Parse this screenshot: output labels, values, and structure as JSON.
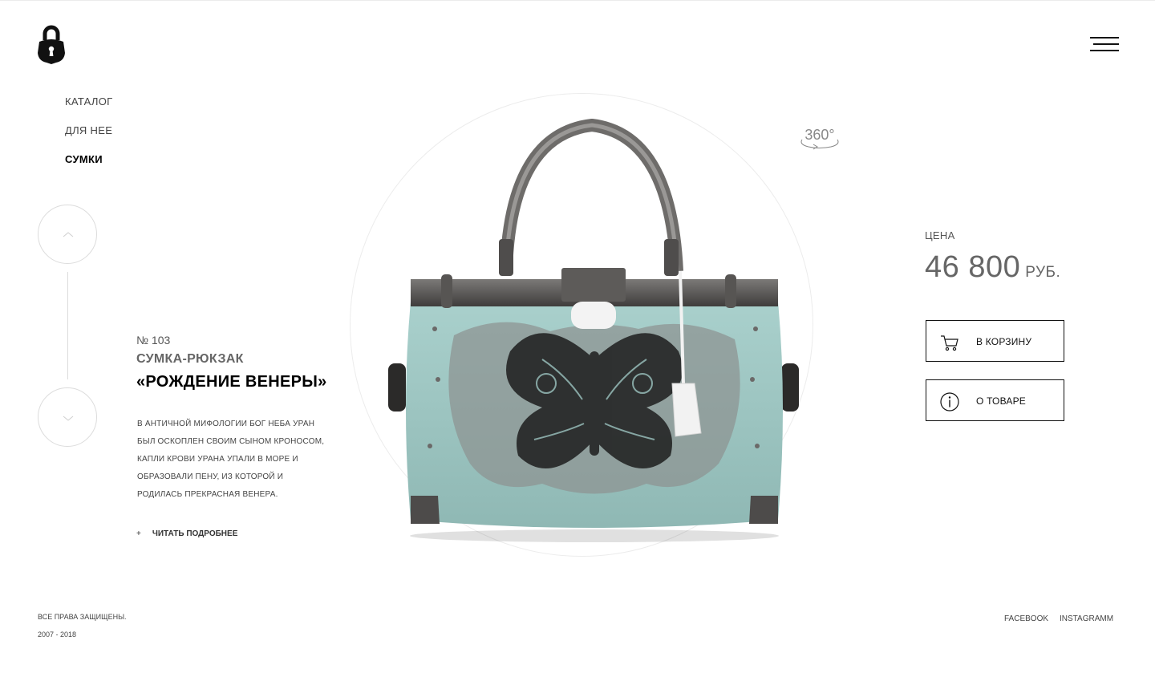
{
  "header": {
    "logo_icon": "padlock-logo-icon",
    "menu_icon": "hamburger-menu-icon"
  },
  "breadcrumbs": [
    {
      "label": "КАТАЛОГ",
      "active": false
    },
    {
      "label": "ДЛЯ НЕЕ",
      "active": false
    },
    {
      "label": "СУМКИ",
      "active": true
    }
  ],
  "slider_nav": {
    "prev_icon": "chevron-up-icon",
    "next_icon": "chevron-down-icon"
  },
  "product": {
    "number": "№ 103",
    "type": "СУМКА-РЮКЗАК",
    "name": "«РОЖДЕНИЕ ВЕНЕРЫ»",
    "description": "В АНТИЧНОЙ МИФОЛОГИИ БОГ НЕБА УРАН БЫЛ ОСКОПЛЕН СВОИМ СЫНОМ КРОНОСОМ, КАПЛИ КРОВИ УРАНА УПАЛИ В МОРЕ И ОБРАЗОВАЛИ ПЕНУ, ИЗ КОТОРОЙ И РОДИЛАСЬ ПРЕКРАСНАЯ ВЕНЕРА.",
    "read_more_plus": "+",
    "read_more": "ЧИТАТЬ ПОДРОБНЕЕ",
    "view_360": "360°",
    "image_icon": "mint-handbag-image",
    "colors": {
      "bag_body": "#9cc4c0",
      "frame": "#5a5856"
    }
  },
  "pricing": {
    "label": "ЦЕНА",
    "value": "46 800",
    "currency": "РУБ."
  },
  "actions": {
    "cart_label": "В КОРЗИНУ",
    "cart_icon": "cart-icon",
    "info_label": "О ТОВАРЕ",
    "info_icon": "info-icon"
  },
  "footer": {
    "rights": "ВСЕ ПРАВА ЗАЩИЩЕНЫ.",
    "years": "2007 - 2018",
    "facebook": "FACEBOOK",
    "instagram": "INSTAGRAMM"
  }
}
